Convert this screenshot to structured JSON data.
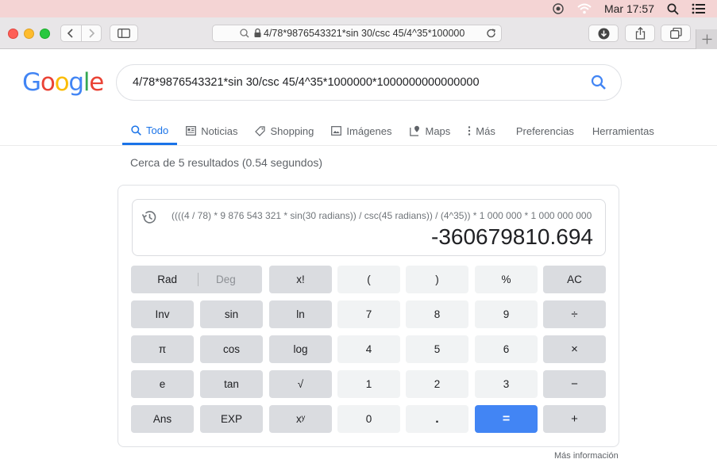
{
  "menubar": {
    "clock": "Mar 17:57"
  },
  "browser": {
    "url": "4/78*9876543321*sin 30/csc 45/4^35*100000"
  },
  "google": {
    "logo_letters": [
      {
        "ch": "G",
        "color": "#4285f4"
      },
      {
        "ch": "o",
        "color": "#ea4335"
      },
      {
        "ch": "o",
        "color": "#fbbc05"
      },
      {
        "ch": "g",
        "color": "#4285f4"
      },
      {
        "ch": "l",
        "color": "#34a853"
      },
      {
        "ch": "e",
        "color": "#ea4335"
      }
    ],
    "query": "4/78*9876543321*sin 30/csc 45/4^35*1000000*1000000000000000",
    "tabs": {
      "todo": "Todo",
      "noticias": "Noticias",
      "shopping": "Shopping",
      "imagenes": "Imágenes",
      "maps": "Maps",
      "mas": "Más",
      "preferencias": "Preferencias",
      "herramientas": "Herramientas"
    },
    "stats": "Cerca de 5 resultados (0.54 segundos)"
  },
  "calculator": {
    "expression": "((((4 / 78) * 9 876 543 321 * sin(30 radians)) / csc(45 radians)) / (4^35)) * 1 000 000 * 1 000 000 000 000 000 =",
    "result": "-360679810.694",
    "keys": {
      "rad": "Rad",
      "deg": "Deg",
      "fact": "x!",
      "lparen": "(",
      "rparen": ")",
      "percent": "%",
      "ac": "AC",
      "inv": "Inv",
      "sin": "sin",
      "ln": "ln",
      "seven": "7",
      "eight": "8",
      "nine": "9",
      "divide": "÷",
      "pi": "π",
      "cos": "cos",
      "log": "log",
      "four": "4",
      "five": "5",
      "six": "6",
      "multiply": "×",
      "e": "e",
      "tan": "tan",
      "sqrt": "√",
      "one": "1",
      "two": "2",
      "three": "3",
      "minus": "−",
      "ans": "Ans",
      "exp": "EXP",
      "pow": "xʸ",
      "zero": "0",
      "dot": ".",
      "equals": "=",
      "plus": "+"
    },
    "more_info": "Más información"
  }
}
